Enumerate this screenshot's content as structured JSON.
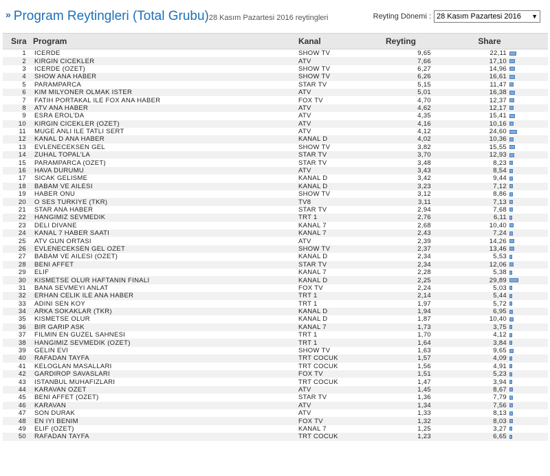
{
  "header": {
    "chevron": "»",
    "title": "Program Reytingleri (Total Grubu)",
    "subtitle": "28 Kasım Pazartesi 2016 reytingleri",
    "period_label": "Reyting Dönemi :",
    "period_value": "28 Kasım Pazartesi 2016",
    "dropdown_icon": "chevron-down-icon"
  },
  "table": {
    "columns": {
      "rank": "Sıra",
      "program": "Program",
      "channel": "Kanal",
      "rating": "Reyting",
      "share": "Share"
    },
    "bar_color": "#7fa9d9",
    "rows": [
      {
        "rank": "1",
        "program": "ICERDE",
        "channel": "SHOW TV",
        "rating": "9,65",
        "share": "22,11"
      },
      {
        "rank": "2",
        "program": "KIRGIN CICEKLER",
        "channel": "ATV",
        "rating": "7,66",
        "share": "17,10"
      },
      {
        "rank": "3",
        "program": "ICERDE (OZET)",
        "channel": "SHOW TV",
        "rating": "6,27",
        "share": "14,96"
      },
      {
        "rank": "4",
        "program": "SHOW ANA HABER",
        "channel": "SHOW TV",
        "rating": "6,26",
        "share": "16,61"
      },
      {
        "rank": "5",
        "program": "PARAMPARCA",
        "channel": "STAR TV",
        "rating": "5,15",
        "share": "11,47"
      },
      {
        "rank": "6",
        "program": "KIM MILYONER OLMAK ISTER",
        "channel": "ATV",
        "rating": "5,01",
        "share": "16,38"
      },
      {
        "rank": "7",
        "program": "FATIH PORTAKAL ILE FOX ANA HABER",
        "channel": "FOX TV",
        "rating": "4,70",
        "share": "12,37"
      },
      {
        "rank": "8",
        "program": "ATV ANA HABER",
        "channel": "ATV",
        "rating": "4,62",
        "share": "12,17"
      },
      {
        "rank": "9",
        "program": "ESRA EROL'DA",
        "channel": "ATV",
        "rating": "4,35",
        "share": "15,41"
      },
      {
        "rank": "10",
        "program": "KIRGIN CICEKLER (OZET)",
        "channel": "ATV",
        "rating": "4,16",
        "share": "10,16"
      },
      {
        "rank": "11",
        "program": "MUGE ANLI ILE TATLI SERT",
        "channel": "ATV",
        "rating": "4,12",
        "share": "24,60"
      },
      {
        "rank": "12",
        "program": "KANAL D ANA HABER",
        "channel": "KANAL D",
        "rating": "4,02",
        "share": "10,36"
      },
      {
        "rank": "13",
        "program": "EVLENECEKSEN GEL",
        "channel": "SHOW TV",
        "rating": "3,82",
        "share": "15,55"
      },
      {
        "rank": "14",
        "program": "ZUHAL TOPAL'LA",
        "channel": "STAR TV",
        "rating": "3,70",
        "share": "12,93"
      },
      {
        "rank": "15",
        "program": "PARAMPARCA (OZET)",
        "channel": "STAR TV",
        "rating": "3,48",
        "share": "8,23"
      },
      {
        "rank": "16",
        "program": "HAVA DURUMU",
        "channel": "ATV",
        "rating": "3,43",
        "share": "8,54"
      },
      {
        "rank": "17",
        "program": "SICAK GELISME",
        "channel": "KANAL D",
        "rating": "3,42",
        "share": "9,44"
      },
      {
        "rank": "18",
        "program": "BABAM VE AILESI",
        "channel": "KANAL D",
        "rating": "3,23",
        "share": "7,12"
      },
      {
        "rank": "19",
        "program": "HABER ONU",
        "channel": "SHOW TV",
        "rating": "3,12",
        "share": "8,86"
      },
      {
        "rank": "20",
        "program": "O SES TURKIYE (TKR)",
        "channel": "TV8",
        "rating": "3,11",
        "share": "7,13"
      },
      {
        "rank": "21",
        "program": "STAR ANA HABER",
        "channel": "STAR TV",
        "rating": "2,94",
        "share": "7,68"
      },
      {
        "rank": "22",
        "program": "HANGIMIZ SEVMEDIK",
        "channel": "TRT 1",
        "rating": "2,76",
        "share": "6,11"
      },
      {
        "rank": "23",
        "program": "DELI DIVANE",
        "channel": "KANAL 7",
        "rating": "2,68",
        "share": "10,40"
      },
      {
        "rank": "24",
        "program": "KANAL 7 HABER SAATI",
        "channel": "KANAL 7",
        "rating": "2,43",
        "share": "7,24"
      },
      {
        "rank": "25",
        "program": "ATV GUN ORTASI",
        "channel": "ATV",
        "rating": "2,39",
        "share": "14,26"
      },
      {
        "rank": "26",
        "program": "EVLENECEKSEN GEL OZET",
        "channel": "SHOW TV",
        "rating": "2,37",
        "share": "13,46"
      },
      {
        "rank": "27",
        "program": "BABAM VE AILESI (OZET)",
        "channel": "KANAL D",
        "rating": "2,34",
        "share": "5,53"
      },
      {
        "rank": "28",
        "program": "BENI AFFET",
        "channel": "STAR TV",
        "rating": "2,34",
        "share": "12,06"
      },
      {
        "rank": "29",
        "program": "ELIF",
        "channel": "KANAL 7",
        "rating": "2,28",
        "share": "5,38"
      },
      {
        "rank": "30",
        "program": "KISMETSE OLUR HAFTANIN FINALI",
        "channel": "KANAL D",
        "rating": "2,25",
        "share": "29,89"
      },
      {
        "rank": "31",
        "program": "BANA SEVMEYI ANLAT",
        "channel": "FOX TV",
        "rating": "2,24",
        "share": "5,03"
      },
      {
        "rank": "32",
        "program": "ERHAN CELIK ILE ANA HABER",
        "channel": "TRT 1",
        "rating": "2,14",
        "share": "5,44"
      },
      {
        "rank": "33",
        "program": "ADINI SEN KOY",
        "channel": "TRT 1",
        "rating": "1,97",
        "share": "5,72"
      },
      {
        "rank": "34",
        "program": "ARKA SOKAKLAR (TKR)",
        "channel": "KANAL D",
        "rating": "1,94",
        "share": "6,95"
      },
      {
        "rank": "35",
        "program": "KISMETSE OLUR",
        "channel": "KANAL D",
        "rating": "1,87",
        "share": "10,40"
      },
      {
        "rank": "36",
        "program": "BIR GARIP ASK",
        "channel": "KANAL 7",
        "rating": "1,73",
        "share": "3,75"
      },
      {
        "rank": "37",
        "program": "FILMIN EN GUZEL SAHNESI",
        "channel": "TRT 1",
        "rating": "1,70",
        "share": "4,12"
      },
      {
        "rank": "38",
        "program": "HANGIMIZ SEVMEDIK (OZET)",
        "channel": "TRT 1",
        "rating": "1,64",
        "share": "3,84"
      },
      {
        "rank": "39",
        "program": "GELIN EVI",
        "channel": "SHOW TV",
        "rating": "1,63",
        "share": "9,65"
      },
      {
        "rank": "40",
        "program": "RAFADAN TAYFA",
        "channel": "TRT COCUK",
        "rating": "1,57",
        "share": "4,09"
      },
      {
        "rank": "41",
        "program": "KELOGLAN MASALLARI",
        "channel": "TRT COCUK",
        "rating": "1,56",
        "share": "4,91"
      },
      {
        "rank": "42",
        "program": "GARDIROP SAVASLARI",
        "channel": "FOX TV",
        "rating": "1,51",
        "share": "5,23"
      },
      {
        "rank": "43",
        "program": "ISTANBUL MUHAFIZLARI",
        "channel": "TRT COCUK",
        "rating": "1,47",
        "share": "3,94"
      },
      {
        "rank": "44",
        "program": "KARAVAN OZET",
        "channel": "ATV",
        "rating": "1,45",
        "share": "8,67"
      },
      {
        "rank": "45",
        "program": "BENI AFFET (OZET)",
        "channel": "STAR TV",
        "rating": "1,36",
        "share": "7,79"
      },
      {
        "rank": "46",
        "program": "KARAVAN",
        "channel": "ATV",
        "rating": "1,34",
        "share": "7,56"
      },
      {
        "rank": "47",
        "program": "SON DURAK",
        "channel": "ATV",
        "rating": "1,33",
        "share": "8,13"
      },
      {
        "rank": "48",
        "program": "EN IYI BENIM",
        "channel": "FOX TV",
        "rating": "1,32",
        "share": "8,03"
      },
      {
        "rank": "49",
        "program": "ELIF (OZET)",
        "channel": "KANAL 7",
        "rating": "1,25",
        "share": "3,27"
      },
      {
        "rank": "50",
        "program": "RAFADAN TAYFA",
        "channel": "TRT COCUK",
        "rating": "1,23",
        "share": "6,65"
      }
    ]
  }
}
